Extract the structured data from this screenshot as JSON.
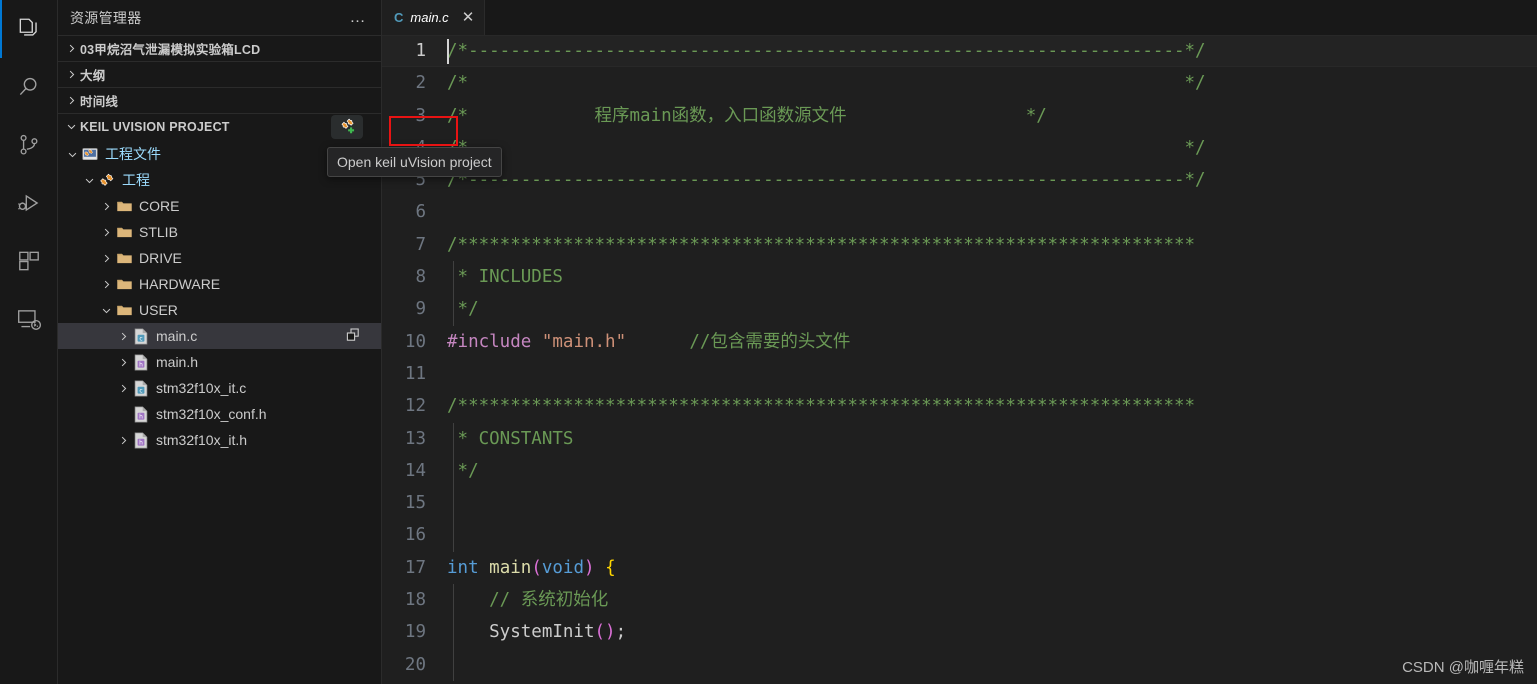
{
  "activity_bar": {
    "items": [
      {
        "name": "explorer",
        "icon": "files-icon",
        "active": true
      },
      {
        "name": "search",
        "icon": "search-icon",
        "active": false
      },
      {
        "name": "source-control",
        "icon": "source-control-icon",
        "active": false
      },
      {
        "name": "run-and-debug",
        "icon": "run-debug-icon",
        "active": false
      },
      {
        "name": "extensions",
        "icon": "extensions-icon",
        "active": false
      },
      {
        "name": "remote-explorer",
        "icon": "remote-icon",
        "active": false
      }
    ]
  },
  "sidebar": {
    "title": "资源管理器",
    "more_actions": "…",
    "sections": [
      {
        "label": "03甲烷沼气泄漏模拟实验箱LCD",
        "expanded": false
      },
      {
        "label": "大纲",
        "expanded": false
      },
      {
        "label": "时间线",
        "expanded": false
      },
      {
        "label": "KEIL UVISION PROJECT",
        "expanded": true
      }
    ],
    "keil_action_title": "Open keil uVision project",
    "tree": [
      {
        "label": "工程文件",
        "indent": 1,
        "twisty": "down",
        "icon": "keil-project-file-icon",
        "kind": "proj",
        "selected": false,
        "trailing": null
      },
      {
        "label": "工程",
        "indent": 2,
        "twisty": "down",
        "icon": "keil-target-icon",
        "kind": "proj",
        "selected": false,
        "trailing": null
      },
      {
        "label": "CORE",
        "indent": 3,
        "twisty": "right",
        "icon": "folder-icon",
        "kind": "folder",
        "selected": false,
        "trailing": null
      },
      {
        "label": "STLIB",
        "indent": 3,
        "twisty": "right",
        "icon": "folder-icon",
        "kind": "folder",
        "selected": false,
        "trailing": null
      },
      {
        "label": "DRIVE",
        "indent": 3,
        "twisty": "right",
        "icon": "folder-icon",
        "kind": "folder",
        "selected": false,
        "trailing": null
      },
      {
        "label": "HARDWARE",
        "indent": 3,
        "twisty": "right",
        "icon": "folder-icon",
        "kind": "folder",
        "selected": false,
        "trailing": null
      },
      {
        "label": "USER",
        "indent": 3,
        "twisty": "down",
        "icon": "folder-icon",
        "kind": "folder",
        "selected": false,
        "trailing": null
      },
      {
        "label": "main.c",
        "indent": 4,
        "twisty": "right",
        "icon": "c-file-icon",
        "kind": "file",
        "selected": true,
        "trailing": "open-file-icon"
      },
      {
        "label": "main.h",
        "indent": 4,
        "twisty": "right",
        "icon": "h-file-icon",
        "kind": "file",
        "selected": false,
        "trailing": null
      },
      {
        "label": "stm32f10x_it.c",
        "indent": 4,
        "twisty": "right",
        "icon": "c-file-icon",
        "kind": "file",
        "selected": false,
        "trailing": null
      },
      {
        "label": "stm32f10x_conf.h",
        "indent": 4,
        "twisty": "none",
        "icon": "h-file-icon",
        "kind": "file",
        "selected": false,
        "trailing": null
      },
      {
        "label": "stm32f10x_it.h",
        "indent": 4,
        "twisty": "right",
        "icon": "h-file-icon",
        "kind": "file",
        "selected": false,
        "trailing": null
      }
    ]
  },
  "editor": {
    "tab": {
      "label": "main.c",
      "language_icon": "C",
      "close": "✕",
      "preview": true
    },
    "first_visible_line": 1,
    "cursor_line": 1,
    "lines": [
      {
        "n": 1,
        "cur": true,
        "indent_guide": false,
        "spans": [
          {
            "t": "/*--------------------------------------------------------------------*/",
            "c": "g"
          }
        ]
      },
      {
        "n": 2,
        "cur": false,
        "indent_guide": false,
        "spans": [
          {
            "t": "/*                                                                    */",
            "c": "g"
          }
        ]
      },
      {
        "n": 3,
        "cur": false,
        "indent_guide": false,
        "spans": [
          {
            "t": "/*            程序main函数，入口函数源文件                 */",
            "c": "g"
          }
        ]
      },
      {
        "n": 4,
        "cur": false,
        "indent_guide": false,
        "spans": [
          {
            "t": "/*                                                                    */",
            "c": "g"
          }
        ]
      },
      {
        "n": 5,
        "cur": false,
        "indent_guide": false,
        "spans": [
          {
            "t": "/*--------------------------------------------------------------------*/",
            "c": "g"
          }
        ]
      },
      {
        "n": 6,
        "cur": false,
        "indent_guide": false,
        "spans": []
      },
      {
        "n": 7,
        "cur": false,
        "indent_guide": false,
        "spans": [
          {
            "t": "/**********************************************************************",
            "c": "g"
          }
        ]
      },
      {
        "n": 8,
        "cur": false,
        "indent_guide": true,
        "spans": [
          {
            "t": " * INCLUDES",
            "c": "g"
          }
        ]
      },
      {
        "n": 9,
        "cur": false,
        "indent_guide": true,
        "spans": [
          {
            "t": " */",
            "c": "g"
          }
        ]
      },
      {
        "n": 10,
        "cur": false,
        "indent_guide": false,
        "spans": [
          {
            "t": "#include",
            "c": "pk"
          },
          {
            "t": " ",
            "c": ""
          },
          {
            "t": "\"main.h\"",
            "c": "st"
          },
          {
            "t": "      ",
            "c": ""
          },
          {
            "t": "//包含需要的头文件",
            "c": "g"
          }
        ]
      },
      {
        "n": 11,
        "cur": false,
        "indent_guide": false,
        "spans": []
      },
      {
        "n": 12,
        "cur": false,
        "indent_guide": false,
        "spans": [
          {
            "t": "/**********************************************************************",
            "c": "g"
          }
        ]
      },
      {
        "n": 13,
        "cur": false,
        "indent_guide": true,
        "spans": [
          {
            "t": " * CONSTANTS",
            "c": "g"
          }
        ]
      },
      {
        "n": 14,
        "cur": false,
        "indent_guide": true,
        "spans": [
          {
            "t": " */",
            "c": "g"
          }
        ]
      },
      {
        "n": 15,
        "cur": false,
        "indent_guide": true,
        "spans": []
      },
      {
        "n": 16,
        "cur": false,
        "indent_guide": true,
        "spans": []
      },
      {
        "n": 17,
        "cur": false,
        "indent_guide": false,
        "spans": [
          {
            "t": "int",
            "c": "kw"
          },
          {
            "t": " ",
            "c": ""
          },
          {
            "t": "main",
            "c": "fn"
          },
          {
            "t": "(",
            "c": "pn"
          },
          {
            "t": "void",
            "c": "kw"
          },
          {
            "t": ")",
            "c": "pn"
          },
          {
            "t": " ",
            "c": ""
          },
          {
            "t": "{",
            "c": "br"
          }
        ]
      },
      {
        "n": 18,
        "cur": false,
        "indent_guide": true,
        "spans": [
          {
            "t": "    // 系统初始化",
            "c": "g"
          }
        ]
      },
      {
        "n": 19,
        "cur": false,
        "indent_guide": true,
        "spans": [
          {
            "t": "    SystemInit",
            "c": ""
          },
          {
            "t": "()",
            "c": "pn"
          },
          {
            "t": ";",
            "c": ""
          }
        ]
      },
      {
        "n": 20,
        "cur": false,
        "indent_guide": true,
        "spans": []
      }
    ]
  },
  "watermark": "CSDN @咖喱年糕",
  "colors": {
    "accent": "#0078d4",
    "comment_green": "#6a9955",
    "keyword_blue": "#569cd6",
    "string_orange": "#ce9178",
    "preproc_pink": "#c586c0",
    "function_yellow": "#dcdcaa",
    "brace_gold": "#ffd700",
    "paren_magenta": "#da70d6",
    "selection_bg": "#37373d",
    "annotation_red": "#e81313",
    "folder_gold": "#dcb67a",
    "keil_orange": "#e8922c",
    "plus_green": "#3fb950"
  }
}
